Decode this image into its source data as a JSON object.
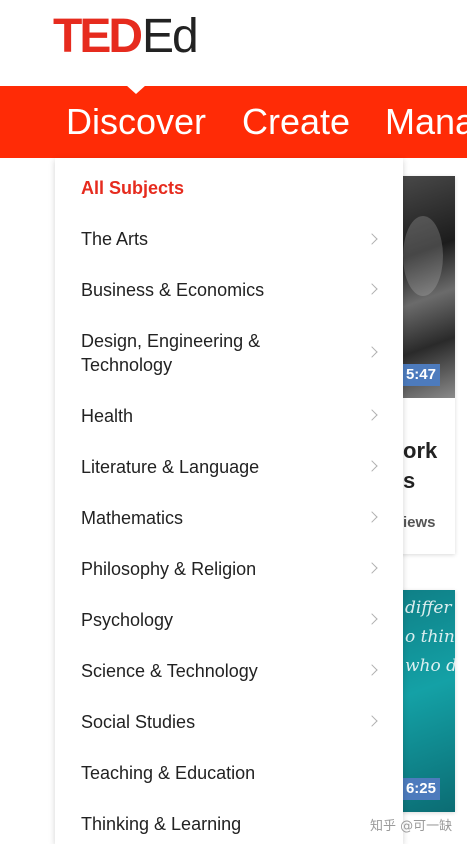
{
  "logo": {
    "part1": "TED",
    "part2": "Ed"
  },
  "nav": {
    "items": [
      "Discover",
      "Create",
      "Mana"
    ]
  },
  "cards": [
    {
      "duration": "5:47",
      "title": "ork\ns",
      "views": "iews"
    },
    {
      "duration": "6:25",
      "thumb_text": "differ\no thin\nwho do"
    }
  ],
  "menu": {
    "active": "All Subjects",
    "items": [
      {
        "label": "The Arts",
        "chevron": true
      },
      {
        "label": "Business & Economics",
        "chevron": true
      },
      {
        "label": "Design, Engineering &\nTechnology",
        "chevron": true
      },
      {
        "label": "Health",
        "chevron": true
      },
      {
        "label": "Literature & Language",
        "chevron": true
      },
      {
        "label": "Mathematics",
        "chevron": true
      },
      {
        "label": "Philosophy & Religion",
        "chevron": true
      },
      {
        "label": "Psychology",
        "chevron": true
      },
      {
        "label": "Science & Technology",
        "chevron": true
      },
      {
        "label": "Social Studies",
        "chevron": true
      },
      {
        "label": "Teaching & Education",
        "chevron": false
      },
      {
        "label": "Thinking & Learning",
        "chevron": false
      }
    ]
  },
  "watermark": "知乎 @可一缺",
  "colors": {
    "brand_red": "#e62b1e",
    "nav_red": "#ff2b06",
    "duration_badge": "#4d7bbd"
  }
}
